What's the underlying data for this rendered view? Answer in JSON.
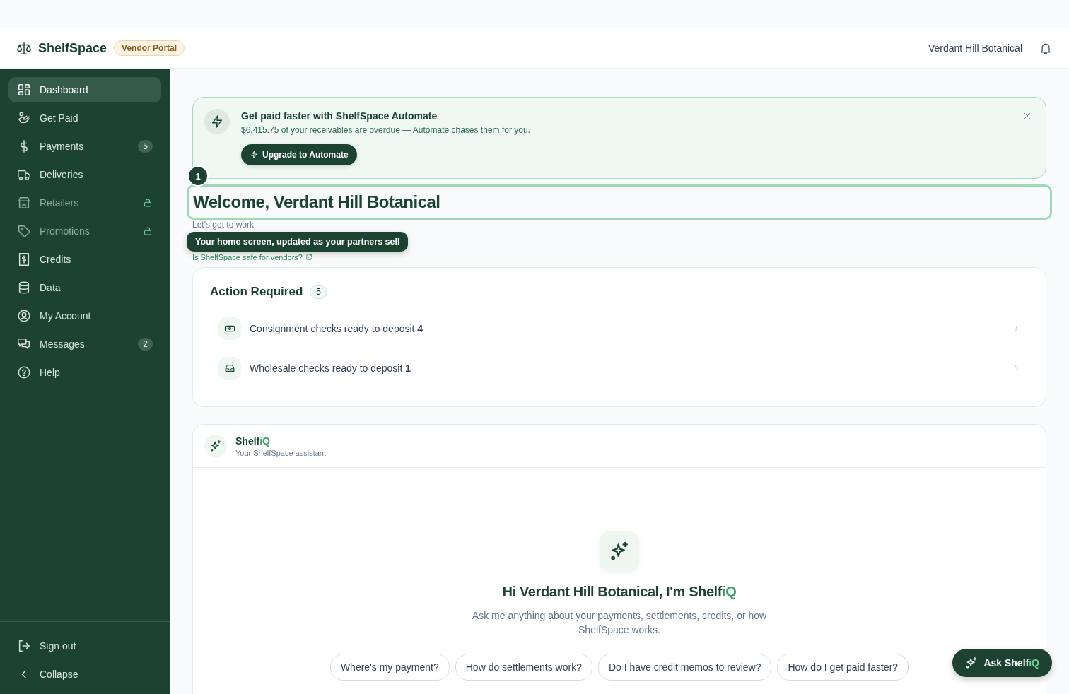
{
  "header": {
    "brand": "ShelfSpace",
    "portal_badge": "Vendor Portal",
    "account_name": "Verdant Hill Botanical"
  },
  "sidebar": {
    "items": [
      {
        "label": "Dashboard",
        "selected": true,
        "locked": false
      },
      {
        "label": "Get Paid",
        "selected": false,
        "locked": false
      },
      {
        "label": "Payments",
        "selected": false,
        "locked": false,
        "badge": "5"
      },
      {
        "label": "Deliveries",
        "selected": false,
        "locked": false
      },
      {
        "label": "Retailers",
        "selected": false,
        "locked": true
      },
      {
        "label": "Promotions",
        "selected": false,
        "locked": true
      },
      {
        "label": "Credits",
        "selected": false,
        "locked": false
      },
      {
        "label": "Data",
        "selected": false,
        "locked": false
      },
      {
        "label": "My Account",
        "selected": false,
        "locked": false
      },
      {
        "label": "Messages",
        "selected": false,
        "locked": false,
        "badge": "2"
      },
      {
        "label": "Help",
        "selected": false,
        "locked": false
      }
    ],
    "footer": [
      {
        "label": "Sign out"
      },
      {
        "label": "Collapse"
      }
    ]
  },
  "banner": {
    "title": "Get paid faster with ShelfSpace Automate",
    "text": "$6,415.75 of your receivables are overdue — Automate chases them for you.",
    "button": "Upgrade to Automate"
  },
  "welcome": {
    "title": "Welcome, Verdant Hill Botanical",
    "subtitle": "Let's get to work",
    "link": "Is ShelfSpace safe for vendors?"
  },
  "tour": {
    "step": "1",
    "tooltip": "Your home screen, updated as your partners sell"
  },
  "action_required": {
    "title": "Action Required",
    "count": "5",
    "items": [
      {
        "text": "Consignment checks ready to deposit",
        "count": "4"
      },
      {
        "text": "Wholesale checks ready to deposit",
        "count": "1"
      }
    ]
  },
  "assistant": {
    "name": "Shelf",
    "name_accent": "iQ",
    "subtitle": "Your ShelfSpace assistant",
    "greeting": "Hi Verdant Hill Botanical, I'm Shelf",
    "greeting_accent": "iQ",
    "intro": "Ask me anything about your payments, settlements, credits, or how ShelfSpace works.",
    "suggestions": [
      "Where's my payment?",
      "How do settlements work?",
      "Do I have credit memos to review?",
      "How do I get paid faster?"
    ]
  },
  "ask_button": {
    "label": "Ask Shelf",
    "accent": "iQ"
  }
}
